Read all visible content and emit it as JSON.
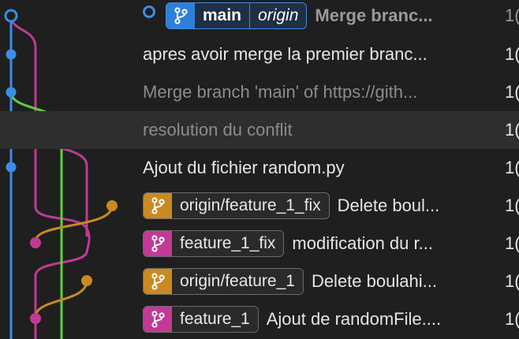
{
  "colors": {
    "blue": "#3a8ee6",
    "pink": "#c23a95",
    "green": "#5fd03a",
    "orange": "#c98a22"
  },
  "commits": [
    {
      "badges": [
        {
          "icon": "branch-icon",
          "color": "blue",
          "labels": [
            "main",
            "origin"
          ]
        }
      ],
      "message": "Merge branc...",
      "date": "1("
    },
    {
      "badges": [],
      "message": "apres avoir merge la premier branc...",
      "date": "1("
    },
    {
      "badges": [],
      "message": "Merge branch 'main' of https://gith...",
      "date": "1("
    },
    {
      "badges": [],
      "message": "resolution du conflit",
      "date": "1("
    },
    {
      "badges": [],
      "message": "Ajout du fichier random.py",
      "date": "1("
    },
    {
      "badges": [
        {
          "icon": "branch-icon",
          "color": "orange",
          "labels": [
            "origin/feature_1_fix"
          ]
        }
      ],
      "message": "Delete boul...",
      "date": "1("
    },
    {
      "badges": [
        {
          "icon": "branch-icon",
          "color": "pink",
          "labels": [
            "feature_1_fix"
          ]
        }
      ],
      "message": "modification du r...",
      "date": "1("
    },
    {
      "badges": [
        {
          "icon": "branch-icon",
          "color": "orange",
          "labels": [
            "origin/feature_1"
          ]
        }
      ],
      "message": "Delete boulahi...",
      "date": "1("
    },
    {
      "badges": [
        {
          "icon": "branch-icon",
          "color": "pink",
          "labels": [
            "feature_1"
          ]
        }
      ],
      "message": "Ajout de randomFile....",
      "date": "1("
    }
  ]
}
